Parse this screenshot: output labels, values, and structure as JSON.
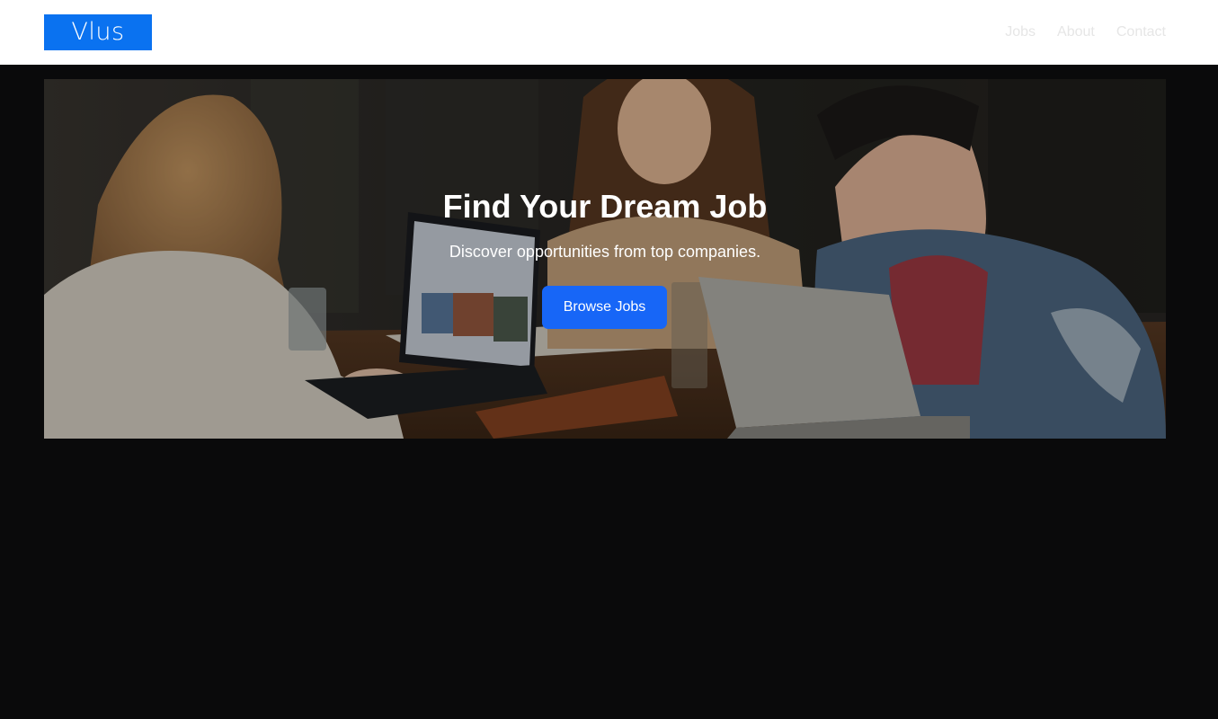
{
  "header": {
    "logo_text": "Vlus",
    "nav": [
      {
        "label": "Jobs"
      },
      {
        "label": "About"
      },
      {
        "label": "Contact"
      }
    ]
  },
  "hero": {
    "title": "Find Your Dream Job",
    "subtitle": "Discover opportunities from top companies.",
    "cta_label": "Browse Jobs"
  },
  "colors": {
    "page_background": "#0a0a0b",
    "header_background": "#ffffff",
    "logo_background": "#0a72f0",
    "nav_text": "#e6e6e6",
    "cta_background": "#1766f7",
    "hero_text": "#ffffff"
  }
}
